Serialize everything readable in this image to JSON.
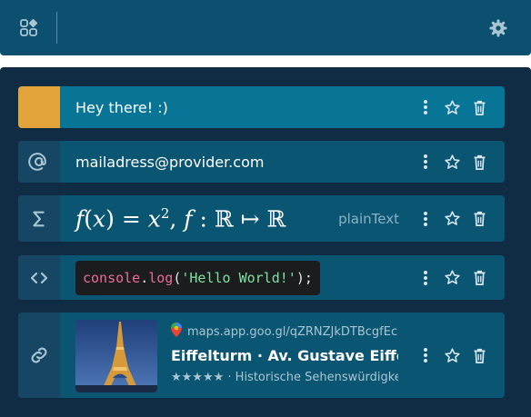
{
  "icons": {
    "apps": "apps-icon",
    "settings": "gear-icon",
    "at": "at-icon",
    "sigma": "sigma-icon",
    "code": "code-icon",
    "link": "link-icon",
    "more": "more-vertical-icon",
    "star": "star-icon",
    "delete": "trash-icon"
  },
  "colors": {
    "topbar": "#0c4f6e",
    "panel": "#0f2c44",
    "row": "#0a5572",
    "row_active": "#087596",
    "swatch": "#e1a33a"
  },
  "clips": [
    {
      "kind": "color",
      "text": "Hey there! :)",
      "swatch": "#e1a33a"
    },
    {
      "kind": "email",
      "text": "mailadress@provider.com"
    },
    {
      "kind": "math",
      "tex_label": "plainText"
    },
    {
      "kind": "code",
      "tokens": {
        "obj": "console",
        "dot": ".",
        "fn": "log",
        "open": "(",
        "str": "'Hello World!'",
        "close": ");"
      }
    },
    {
      "kind": "link",
      "url": "maps.app.goo.gl/qZRNZJkDTBcgfEc",
      "title": "Eiffelturm · Av. Gustave Eiffel, Paris",
      "subtitle": "★★★★★ · Historische Sehenswürdigkeit"
    }
  ]
}
